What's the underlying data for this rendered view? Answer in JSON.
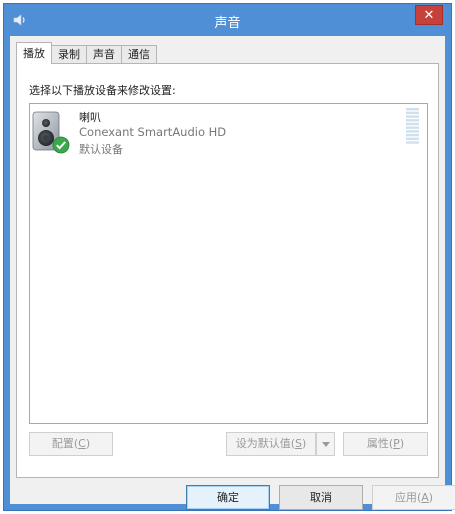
{
  "window": {
    "title": "声音",
    "close_label": "✕",
    "accent": "#4f8fd6",
    "close_color": "#c7413b"
  },
  "tabs": [
    {
      "label": "播放",
      "active": true
    },
    {
      "label": "录制",
      "active": false
    },
    {
      "label": "声音",
      "active": false
    },
    {
      "label": "通信",
      "active": false
    }
  ],
  "playback": {
    "instruction": "选择以下播放设备来修改设置:",
    "devices": [
      {
        "name": "喇叭",
        "driver": "Conexant SmartAudio HD",
        "status": "默认设备",
        "icon": "speaker-icon",
        "badge": "default-check-icon",
        "level": 0
      }
    ],
    "buttons": {
      "configure": {
        "label": "配置",
        "key": "C"
      },
      "set_default": {
        "label": "设为默认值",
        "key": "S"
      },
      "properties": {
        "label": "属性",
        "key": "P"
      }
    }
  },
  "dialog_buttons": {
    "ok": "确定",
    "cancel": "取消",
    "apply": {
      "label": "应用",
      "key": "A"
    }
  }
}
